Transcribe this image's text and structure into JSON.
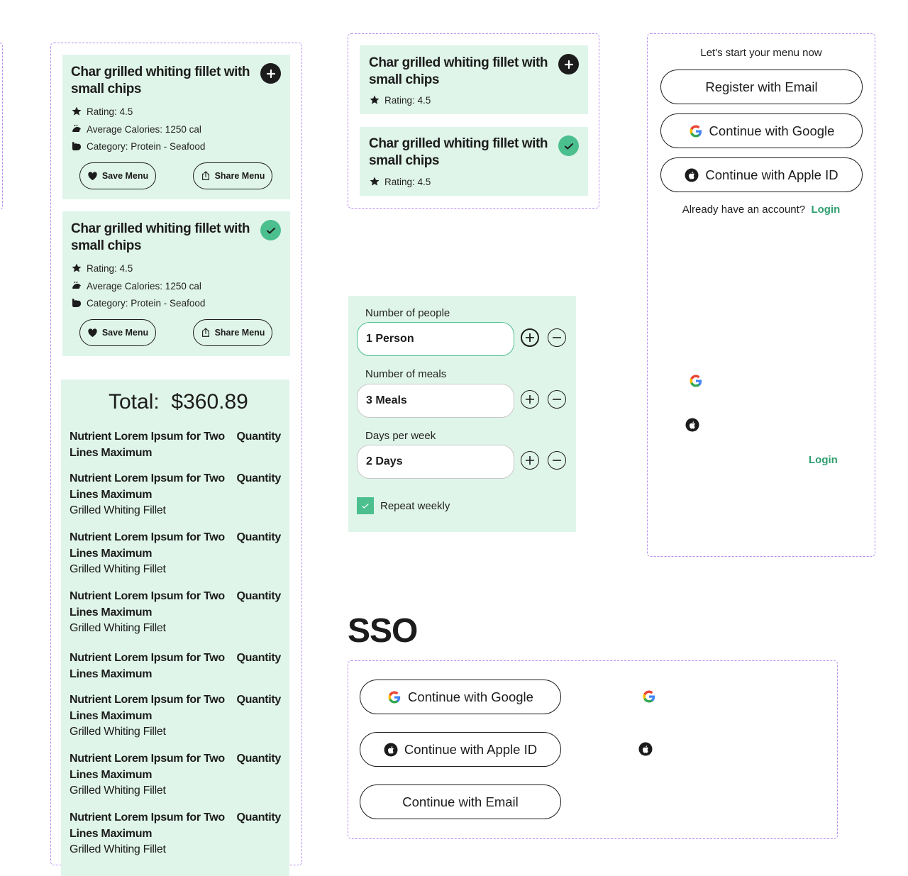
{
  "menu_card": {
    "title": "Char grilled whiting fillet with small chips",
    "rating": "Rating: 4.5",
    "calories": "Average Calories: 1250 cal",
    "category": "Category: Protein - Seafood",
    "save_label": "Save Menu",
    "share_label": "Share Menu"
  },
  "summary": {
    "total_label": "Total:",
    "total_value": "$360.89",
    "rows": [
      {
        "name": "Nutrient Lorem Ipsum for Two Lines Maximum",
        "qty": "Quantity",
        "sub": ""
      },
      {
        "name": "Nutrient Lorem Ipsum for Two Lines Maximum",
        "qty": "Quantity",
        "sub": "Grilled Whiting Fillet"
      },
      {
        "name": "Nutrient Lorem Ipsum for Two Lines Maximum",
        "qty": "Quantity",
        "sub": "Grilled Whiting Fillet"
      },
      {
        "name": "Nutrient Lorem Ipsum for Two Lines Maximum",
        "qty": "Quantity",
        "sub": "Grilled Whiting Fillet"
      },
      {
        "name": "Nutrient Lorem Ipsum for Two Lines Maximum",
        "qty": "Quantity",
        "sub": ""
      },
      {
        "name": "Nutrient Lorem Ipsum for Two Lines Maximum",
        "qty": "Quantity",
        "sub": "Grilled Whiting Fillet"
      },
      {
        "name": "Nutrient Lorem Ipsum for Two Lines Maximum",
        "qty": "Quantity",
        "sub": "Grilled Whiting Fillet"
      },
      {
        "name": "Nutrient Lorem Ipsum for Two Lines Maximum",
        "qty": "Quantity",
        "sub": "Grilled Whiting Fillet"
      }
    ]
  },
  "plan_form": {
    "people_label": "Number of people",
    "people_value": "1 Person",
    "meals_label": "Number of meals",
    "meals_value": "3 Meals",
    "days_label": "Days per week",
    "days_value": "2 Days",
    "repeat_label": "Repeat weekly",
    "repeat_checked": true
  },
  "auth_panel": {
    "heading": "Let's start your menu now",
    "register_label": "Register with Email",
    "google_label": "Continue with Google",
    "apple_label": "Continue with Apple ID",
    "account_prompt": "Already have an account?",
    "login_label": "Login"
  },
  "sso": {
    "title": "SSO",
    "google_label": "Continue with Google",
    "apple_label": "Continue with Apple ID",
    "email_label": "Continue with Email"
  },
  "icons": {
    "add": "plus-icon",
    "selected": "check-icon",
    "rating": "star-icon",
    "calories": "calories-icon",
    "category": "muscle-icon",
    "save": "heart-icon",
    "share": "share-icon",
    "google": "google-icon",
    "apple": "apple-icon"
  },
  "colors": {
    "card_bg": "#e0f5ea",
    "accent": "#4cbf8f",
    "link": "#2e9e6e",
    "dashed_outline": "#b48cf0",
    "text": "#1c1c1c"
  }
}
